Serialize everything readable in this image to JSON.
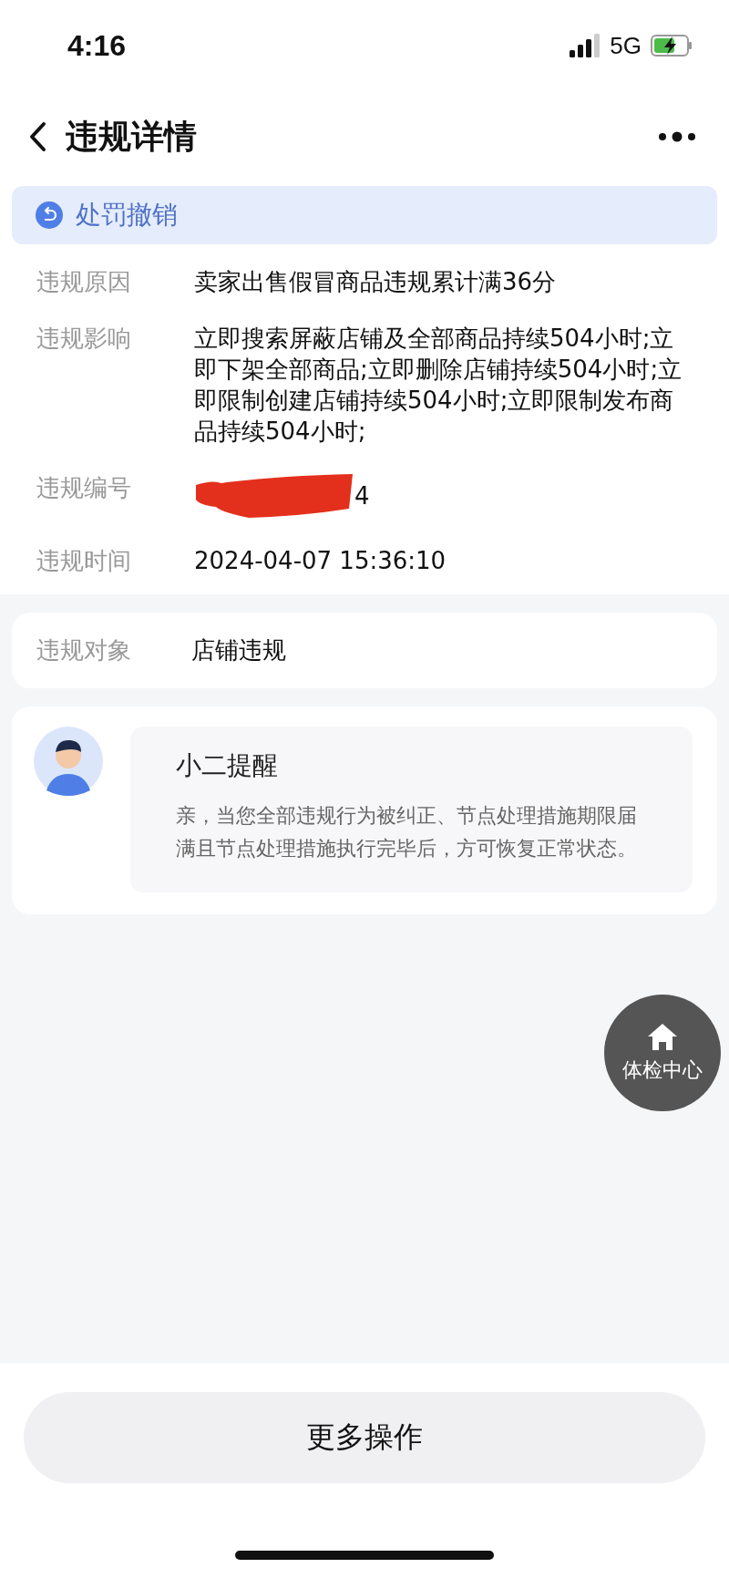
{
  "status_bar": {
    "time": "4:16",
    "network": "5G"
  },
  "nav": {
    "title": "违规详情"
  },
  "notice": {
    "label": "处罚撤销"
  },
  "details": [
    {
      "label": "违规原因",
      "value": "卖家出售假冒商品违规累计满36分"
    },
    {
      "label": "违规影响",
      "value": "立即搜索屏蔽店铺及全部商品持续504小时;立即下架全部商品;立即删除店铺持续504小时;立即限制创建店铺持续504小时;立即限制发布商品持续504小时;"
    },
    {
      "label": "违规编号",
      "value": "4",
      "redacted": true
    },
    {
      "label": "违规时间",
      "value": "2024-04-07 15:36:10"
    }
  ],
  "target": {
    "label": "违规对象",
    "value": "店铺违规"
  },
  "reminder": {
    "title": "小二提醒",
    "body": "亲，当您全部违规行为被纠正、节点处理措施期限届满且节点处理措施执行完毕后，方可恢复正常状态。"
  },
  "float_button": {
    "label": "体检中心"
  },
  "footer": {
    "button": "更多操作"
  }
}
